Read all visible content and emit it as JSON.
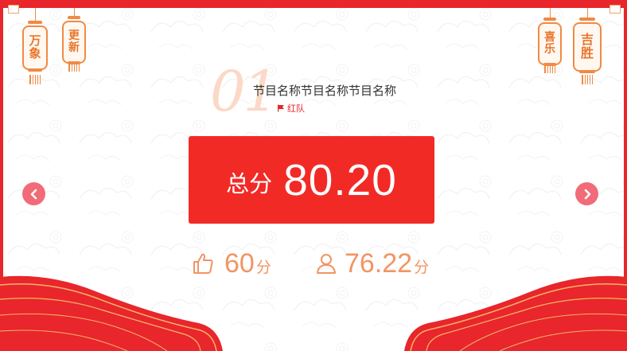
{
  "lanterns": {
    "left_1": [
      "万",
      "象"
    ],
    "left_2": [
      "更",
      "新"
    ],
    "right_1": [
      "喜",
      "乐"
    ],
    "right_2": [
      "吉",
      "胜"
    ]
  },
  "program": {
    "index": "01",
    "name": "节目名称节目名称节目名称",
    "team": "红队",
    "team_icon": "flag-icon"
  },
  "score": {
    "label": "总分",
    "value": "80.20"
  },
  "stats": {
    "likes": {
      "icon": "thumbs-up-icon",
      "value": "60",
      "unit": "分"
    },
    "judges": {
      "icon": "user-icon",
      "value": "76.22",
      "unit": "分"
    }
  },
  "nav": {
    "prev_icon": "chevron-left-icon",
    "next_icon": "chevron-right-icon"
  },
  "colors": {
    "primary_red": "#f22a26",
    "frame_red": "#e8262b",
    "accent_orange": "#f29464",
    "nav_pink": "#f26b78",
    "index_faded": "#fbd9c6"
  }
}
